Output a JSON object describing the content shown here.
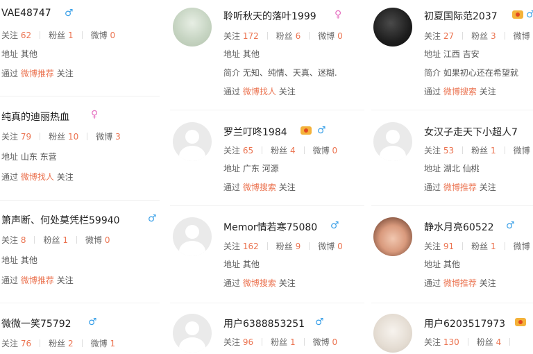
{
  "labels": {
    "follow": "关注",
    "fans": "粉丝",
    "weibo": "微博",
    "address": "地址",
    "intro": "简介",
    "via": "通过"
  },
  "cards": [
    {
      "name": "VAE48747",
      "gender": "male",
      "follow": "62",
      "fans": "1",
      "weibo": "0",
      "address": "其他",
      "via": "微博推荐",
      "follow_action": "关注"
    },
    {
      "name": "聆听秋天的落叶1999",
      "gender": "female",
      "follow": "172",
      "fans": "6",
      "weibo": "0",
      "address": "其他",
      "intro": "无知、纯情、天真、迷糊.",
      "via": "微博找人",
      "follow_action": "关注"
    },
    {
      "name": "初夏国际范2037",
      "gender": "male",
      "follow": "27",
      "fans": "3",
      "weibo": "",
      "address": "江西 吉安",
      "intro": "如果初心还在希望就",
      "via": "微博搜索",
      "follow_action": "关注"
    },
    {
      "name": "纯真的迪丽热血",
      "gender": "female",
      "follow": "79",
      "fans": "10",
      "weibo": "3",
      "address": "山东 东营",
      "via": "微博找人",
      "follow_action": "关注"
    },
    {
      "name": "罗兰叮咚1984",
      "gender": "male",
      "follow": "65",
      "fans": "4",
      "weibo": "0",
      "address": "广东 河源",
      "via": "微博搜索",
      "follow_action": "关注"
    },
    {
      "name": "女汉子走天下小超人7",
      "gender": "male",
      "follow": "53",
      "fans": "1",
      "weibo": "",
      "address": "湖北 仙桃",
      "via": "微博推荐",
      "follow_action": "关注"
    },
    {
      "name": "箫声断、何处莫凭栏59940",
      "gender": "male",
      "follow": "8",
      "fans": "1",
      "weibo": "0",
      "address": "其他",
      "via": "微博推荐",
      "follow_action": "关注"
    },
    {
      "name": "Memor情若寒75080",
      "gender": "male",
      "follow": "162",
      "fans": "9",
      "weibo": "0",
      "address": "其他",
      "via": "微博搜索",
      "follow_action": "关注"
    },
    {
      "name": "静水月亮60522",
      "gender": "male",
      "follow": "91",
      "fans": "1",
      "weibo": "",
      "address": "其他",
      "via": "微博推荐",
      "follow_action": "关注"
    },
    {
      "name": "微微一笑75792",
      "gender": "male",
      "follow": "76",
      "fans": "2",
      "weibo": "1"
    },
    {
      "name": "用户6388853251",
      "gender": "male",
      "follow": "96",
      "fans": "1",
      "weibo": "0"
    },
    {
      "name": "用户6203517973",
      "gender": "male",
      "follow": "130",
      "fans": "4",
      "weibo": ""
    }
  ]
}
